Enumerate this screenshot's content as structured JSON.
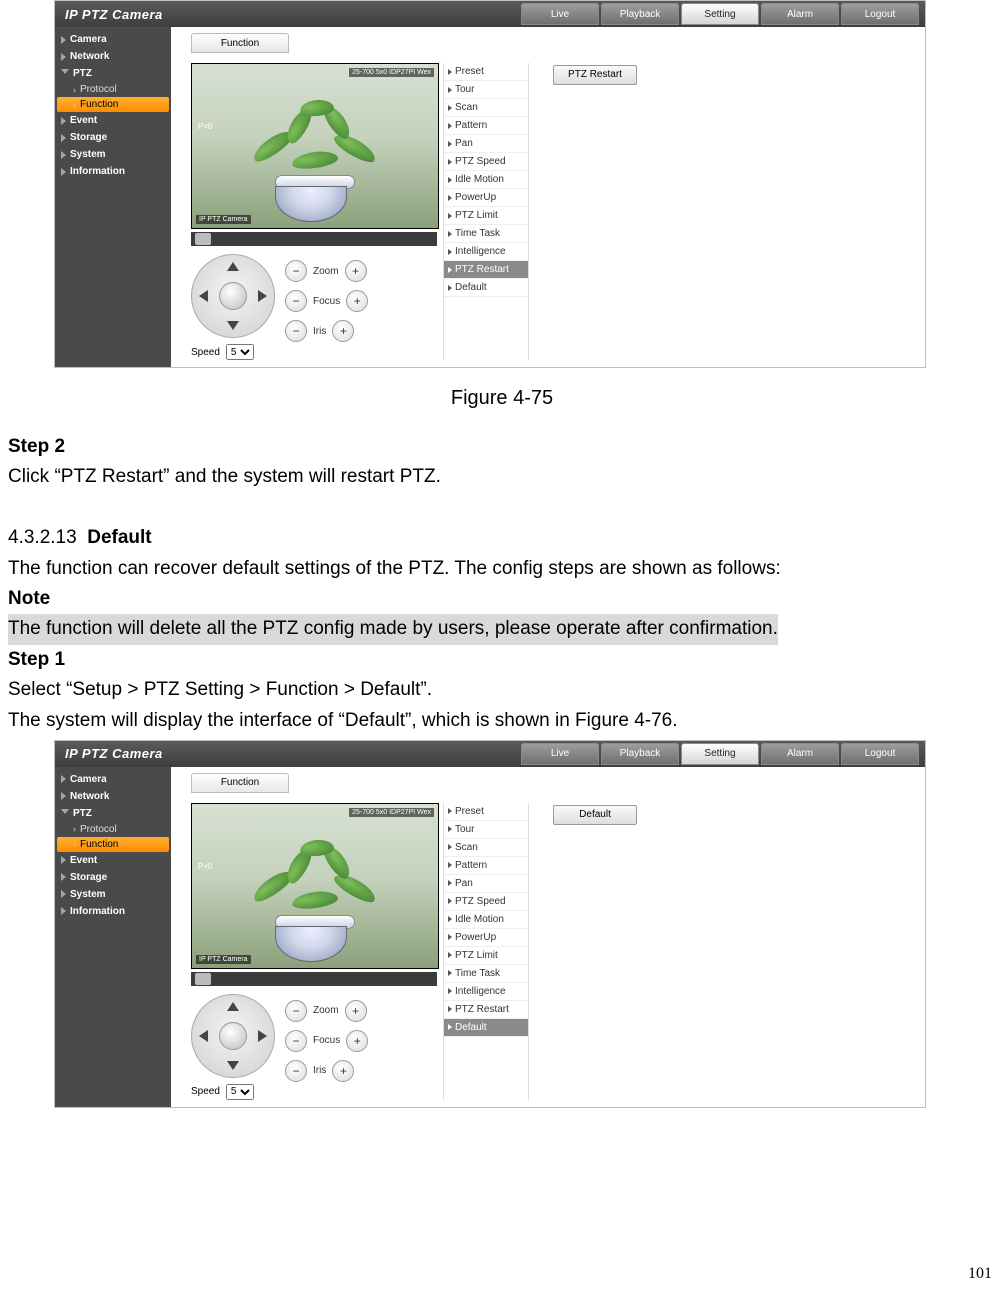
{
  "page_number": "101",
  "prose": {
    "fig_caption_1": "Figure 4-75",
    "step2_h": "Step 2",
    "step2_t": "Click “PTZ Restart” and the system will restart PTZ.",
    "sec_num": "4.3.2.13",
    "sec_title": "Default",
    "sec_desc": "The function can recover default settings of the PTZ. The config steps are shown as follows:",
    "note_h": "Note",
    "note_t": "The function will delete all the PTZ config made by users, please operate after confirmation.",
    "step1_h": "Step 1",
    "step1_t1": "Select “Setup > PTZ Setting > Function > Default”.",
    "step1_t2": "The system will display the interface of “Default”, which is shown in Figure 4-76."
  },
  "ui": {
    "brand": "IP PTZ Camera",
    "tabs": [
      "Live",
      "Playback",
      "Setting",
      "Alarm",
      "Logout"
    ],
    "tab_selected": "Setting",
    "help": "?",
    "sidebar": [
      {
        "label": "Camera",
        "type": "cat"
      },
      {
        "label": "Network",
        "type": "cat"
      },
      {
        "label": "PTZ",
        "type": "cat-exp"
      },
      {
        "label": "Protocol",
        "type": "sub"
      },
      {
        "label": "Function",
        "type": "sub-active"
      },
      {
        "label": "Event",
        "type": "cat"
      },
      {
        "label": "Storage",
        "type": "cat"
      },
      {
        "label": "System",
        "type": "cat"
      },
      {
        "label": "Information",
        "type": "cat"
      }
    ],
    "page_tab": "Function",
    "video": {
      "osd_tr": "25-700 5x0 IDP27PI Wex",
      "osd_ml": "P×0",
      "osd_bl": "IP PTZ Camera"
    },
    "controls": {
      "zoom": "Zoom",
      "focus": "Focus",
      "iris": "Iris",
      "minus": "−",
      "plus": "+",
      "speed_label": "Speed",
      "speed_value": "5"
    },
    "func_items": [
      "Preset",
      "Tour",
      "Scan",
      "Pattern",
      "Pan",
      "PTZ Speed",
      "Idle Motion",
      "PowerUp",
      "PTZ Limit",
      "Time Task",
      "Intelligence",
      "PTZ Restart",
      "Default"
    ]
  },
  "shot1": {
    "selected_func": "PTZ Restart",
    "button": "PTZ Restart"
  },
  "shot2": {
    "selected_func": "Default",
    "button": "Default"
  }
}
